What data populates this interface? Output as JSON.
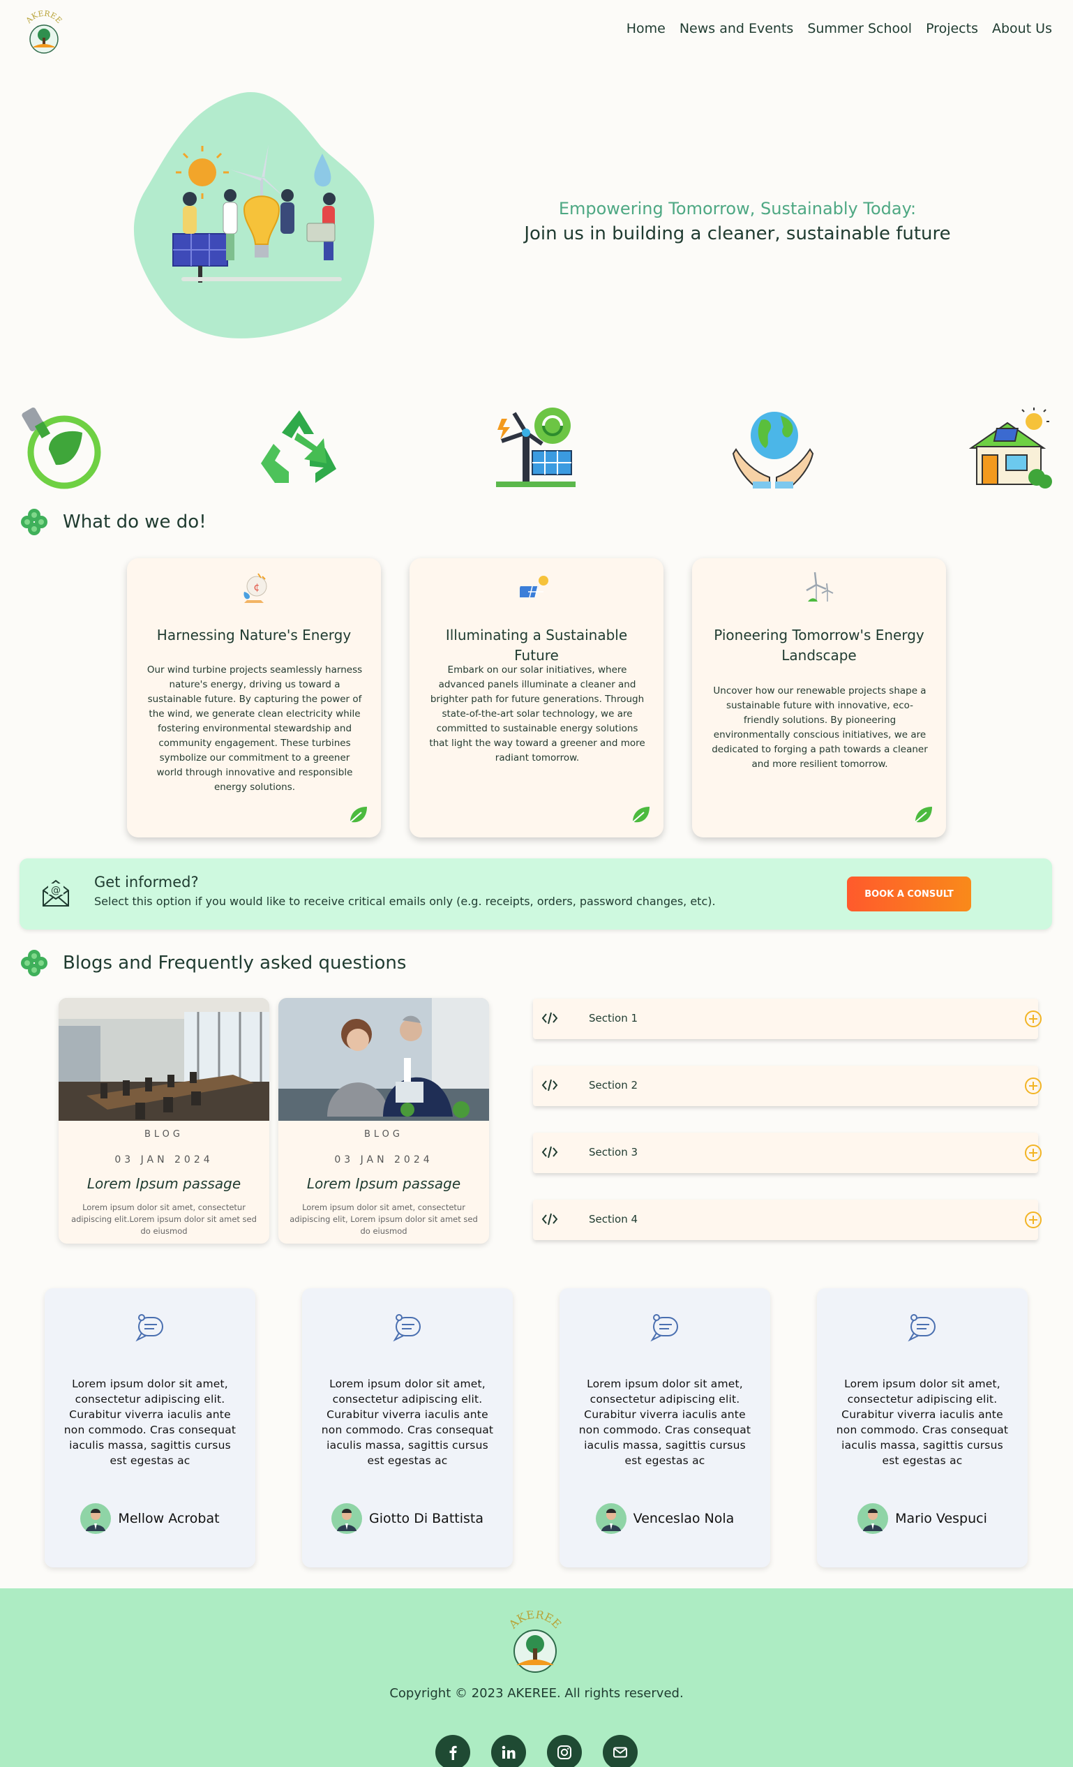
{
  "nav": {
    "logo_text": "AKEREE",
    "links": [
      "Home",
      "News and Events",
      "Summer School",
      "Projects",
      "About Us"
    ]
  },
  "hero": {
    "subtitle": "Empowering Tomorrow, Sustainably Today:",
    "title": "Join us in building a cleaner, sustainable future"
  },
  "icons": [
    "energy-plug-leaf-icon",
    "recycle-icon",
    "wind-solar-icon",
    "globe-hands-icon",
    "solar-house-icon"
  ],
  "what": {
    "heading": "What do we do!",
    "cards": [
      {
        "icon": "energy-bulb-icon",
        "title": "Harnessing Nature's Energy",
        "text": "Our wind turbine projects seamlessly harness nature's energy, driving us toward a sustainable future. By capturing the power of the wind, we generate clean electricity while fostering environmental stewardship and community engagement. These turbines symbolize our commitment to a greener world through innovative and responsible energy solutions."
      },
      {
        "icon": "solar-panel-icon",
        "title": "Illuminating a Sustainable Future",
        "text": "Embark on our solar initiatives, where advanced panels illuminate a cleaner and brighter path for future generations. Through state-of-the-art solar technology, we are committed to sustainable energy solutions that light the way toward a greener and more radiant tomorrow."
      },
      {
        "icon": "wind-turbine-icon",
        "title": "Pioneering Tomorrow's Energy Landscape",
        "text": "Uncover how our renewable projects shape a sustainable future with innovative, eco-friendly solutions. By pioneering environmentally conscious initiatives, we are dedicated to forging a path towards a cleaner and more resilient tomorrow."
      }
    ]
  },
  "inform": {
    "title": "Get informed?",
    "text": "Select this option if you would like to receive critical emails only (e.g. receipts, orders, password changes, etc).",
    "button": "BOOK A CONSULT"
  },
  "blogs": {
    "heading": "Blogs and Frequently asked questions",
    "posts": [
      {
        "kind": "BLOG",
        "date": "03 JAN 2024",
        "title": "Lorem Ipsum passage",
        "excerpt": "Lorem ipsum dolor sit amet, consectetur adipiscing elit.Lorem ipsum dolor sit amet sed do eiusmod"
      },
      {
        "kind": "BLOG",
        "date": "03 JAN 2024",
        "title": "Lorem Ipsum passage",
        "excerpt": "Lorem ipsum dolor sit amet, consectetur adipiscing elit, Lorem ipsum dolor sit amet sed do eiusmod"
      }
    ],
    "faq": [
      "Section 1",
      "Section 2",
      "Section 3",
      "Section 4"
    ]
  },
  "testimonials": [
    {
      "text": "Lorem ipsum dolor sit amet, consectetur adipiscing elit. Curabitur viverra iaculis ante non commodo. Cras consequat iaculis massa, sagittis cursus est egestas ac",
      "name": "Mellow Acrobat"
    },
    {
      "text": "Lorem ipsum dolor sit amet, consectetur adipiscing elit. Curabitur viverra iaculis ante non commodo. Cras consequat iaculis massa, sagittis cursus est egestas ac",
      "name": "Giotto Di Battista"
    },
    {
      "text": "Lorem ipsum dolor sit amet, consectetur adipiscing elit. Curabitur viverra iaculis ante non commodo. Cras consequat iaculis massa, sagittis cursus est egestas ac",
      "name": "Venceslao Nola"
    },
    {
      "text": "Lorem ipsum dolor sit amet, consectetur adipiscing elit. Curabitur viverra iaculis ante non commodo. Cras consequat iaculis massa, sagittis cursus est egestas ac",
      "name": "Mario Vespuci"
    }
  ],
  "footer": {
    "logo_text": "AKEREE",
    "copyright": "Copyright © 2023 AKEREE. All rights reserved.",
    "socials": [
      "facebook-icon",
      "linkedin-icon",
      "instagram-icon",
      "email-icon"
    ]
  },
  "colors": {
    "page_bg": "#fcfbf8",
    "accent_green": "#4ea883",
    "card_bg": "#fff7ee",
    "inform_bg": "#cef9df",
    "footer_bg": "#adecc3",
    "button_orange": "#ff5a2c",
    "faq_plus": "#f2b424"
  }
}
